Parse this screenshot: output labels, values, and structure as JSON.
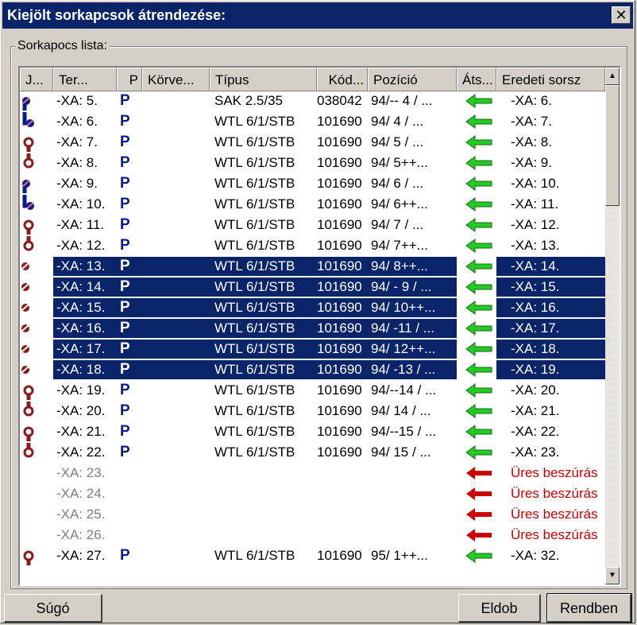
{
  "window": {
    "title": "Kiejölt sorkapcsok átrendezése:",
    "close_glyph": "✕"
  },
  "group": {
    "label": "Sorkapocs lista:"
  },
  "columns": [
    "J...",
    "Ter...",
    "P",
    "Körve...",
    "Típus",
    "Kód...",
    "Pozíció",
    "Áts...",
    "Eredeti sorsz"
  ],
  "rows": [
    {
      "jumper": "blue-top",
      "terminal": "-XA: 5.",
      "p": "P",
      "type": "SAK 2.5/35",
      "code": "038042",
      "position": "94/-- 4  / ...",
      "arrow": "green",
      "original": "-XA: 6.",
      "selected": false,
      "empty": false
    },
    {
      "jumper": "blue-bottom",
      "terminal": "-XA: 6.",
      "p": "P",
      "type": "WTL 6/1/STB",
      "code": "101690",
      "position": "94/  4  / ...",
      "arrow": "green",
      "original": "-XA: 7.",
      "selected": false,
      "empty": false
    },
    {
      "jumper": "red-top",
      "terminal": "-XA: 7.",
      "p": "P",
      "type": "WTL 6/1/STB",
      "code": "101690",
      "position": "94/  5  / ...",
      "arrow": "green",
      "original": "-XA: 8.",
      "selected": false,
      "empty": false
    },
    {
      "jumper": "red-bottom",
      "terminal": "-XA: 8.",
      "p": "P",
      "type": "WTL 6/1/STB",
      "code": "101690",
      "position": "94/  5++...",
      "arrow": "green",
      "original": "-XA: 9.",
      "selected": false,
      "empty": false
    },
    {
      "jumper": "blue-top",
      "terminal": "-XA: 9.",
      "p": "P",
      "type": "WTL 6/1/STB",
      "code": "101690",
      "position": "94/  6  / ...",
      "arrow": "green",
      "original": "-XA: 10.",
      "selected": false,
      "empty": false
    },
    {
      "jumper": "blue-bottom",
      "terminal": "-XA: 10.",
      "p": "P",
      "type": "WTL 6/1/STB",
      "code": "101690",
      "position": "94/  6++...",
      "arrow": "green",
      "original": "-XA: 11.",
      "selected": false,
      "empty": false
    },
    {
      "jumper": "red-top",
      "terminal": "-XA: 11.",
      "p": "P",
      "type": "WTL 6/1/STB",
      "code": "101690",
      "position": "94/  7  / ...",
      "arrow": "green",
      "original": "-XA: 12.",
      "selected": false,
      "empty": false
    },
    {
      "jumper": "red-bottom",
      "terminal": "-XA: 12.",
      "p": "P",
      "type": "WTL 6/1/STB",
      "code": "101690",
      "position": "94/  7++...",
      "arrow": "green",
      "original": "-XA: 13.",
      "selected": false,
      "empty": false
    },
    {
      "jumper": "sel",
      "terminal": "-XA: 13.",
      "p": "P",
      "type": "WTL 6/1/STB",
      "code": "101690",
      "position": "94/  8++...",
      "arrow": "green",
      "original": "-XA: 14.",
      "selected": true,
      "empty": false
    },
    {
      "jumper": "sel",
      "terminal": "-XA: 14.",
      "p": "P",
      "type": "WTL 6/1/STB",
      "code": "101690",
      "position": "94/ - 9  / ...",
      "arrow": "green",
      "original": "-XA: 15.",
      "selected": true,
      "empty": false
    },
    {
      "jumper": "sel",
      "terminal": "-XA: 15.",
      "p": "P",
      "type": "WTL 6/1/STB",
      "code": "101690",
      "position": "94/  10++...",
      "arrow": "green",
      "original": "-XA: 16.",
      "selected": true,
      "empty": false
    },
    {
      "jumper": "sel",
      "terminal": "-XA: 16.",
      "p": "P",
      "type": "WTL 6/1/STB",
      "code": "101690",
      "position": "94/ -11  / ...",
      "arrow": "green",
      "original": "-XA: 17.",
      "selected": true,
      "empty": false
    },
    {
      "jumper": "sel",
      "terminal": "-XA: 17.",
      "p": "P",
      "type": "WTL 6/1/STB",
      "code": "101690",
      "position": "94/  12++...",
      "arrow": "green",
      "original": "-XA: 18.",
      "selected": true,
      "empty": false
    },
    {
      "jumper": "sel",
      "terminal": "-XA: 18.",
      "p": "P",
      "type": "WTL 6/1/STB",
      "code": "101690",
      "position": "94/ -13  / ...",
      "arrow": "green",
      "original": "-XA: 19.",
      "selected": true,
      "empty": false
    },
    {
      "jumper": "red-top",
      "terminal": "-XA: 19.",
      "p": "P",
      "type": "WTL 6/1/STB",
      "code": "101690",
      "position": "94/--14  / ...",
      "arrow": "green",
      "original": "-XA: 20.",
      "selected": false,
      "empty": false
    },
    {
      "jumper": "red-bottom",
      "terminal": "-XA: 20.",
      "p": "P",
      "type": "WTL 6/1/STB",
      "code": "101690",
      "position": "94/  14  / ...",
      "arrow": "green",
      "original": "-XA: 21.",
      "selected": false,
      "empty": false
    },
    {
      "jumper": "red-top",
      "terminal": "-XA: 21.",
      "p": "P",
      "type": "WTL 6/1/STB",
      "code": "101690",
      "position": "94/--15  / ...",
      "arrow": "green",
      "original": "-XA: 22.",
      "selected": false,
      "empty": false
    },
    {
      "jumper": "red-bottom",
      "terminal": "-XA: 22.",
      "p": "P",
      "type": "WTL 6/1/STB",
      "code": "101690",
      "position": "94/  15  / ...",
      "arrow": "green",
      "original": "-XA: 23.",
      "selected": false,
      "empty": false
    },
    {
      "jumper": "none",
      "terminal": "-XA: 23.",
      "p": "",
      "type": "",
      "code": "",
      "position": "",
      "arrow": "red",
      "original": "Üres beszúrás",
      "selected": false,
      "empty": true
    },
    {
      "jumper": "none",
      "terminal": "-XA: 24.",
      "p": "",
      "type": "",
      "code": "",
      "position": "",
      "arrow": "red",
      "original": "Üres beszúrás",
      "selected": false,
      "empty": true
    },
    {
      "jumper": "none",
      "terminal": "-XA: 25.",
      "p": "",
      "type": "",
      "code": "",
      "position": "",
      "arrow": "red",
      "original": "Üres beszúrás",
      "selected": false,
      "empty": true
    },
    {
      "jumper": "none",
      "terminal": "-XA: 26.",
      "p": "",
      "type": "",
      "code": "",
      "position": "",
      "arrow": "red",
      "original": "Üres beszúrás",
      "selected": false,
      "empty": true
    },
    {
      "jumper": "red-top",
      "terminal": "-XA: 27.",
      "p": "P",
      "type": "WTL 6/1/STB",
      "code": "101690",
      "position": "95/  1++...",
      "arrow": "green",
      "original": "-XA: 32.",
      "selected": false,
      "empty": false
    }
  ],
  "buttons": {
    "help": "Súgó",
    "discard": "Eldob",
    "ok": "Rendben"
  },
  "colors": {
    "selection": "#0a246a",
    "green_arrow": "#22cc22",
    "red_arrow": "#cc0000",
    "jumper_red": "#8b1a1a",
    "jumper_blue": "#0a1a8c"
  }
}
